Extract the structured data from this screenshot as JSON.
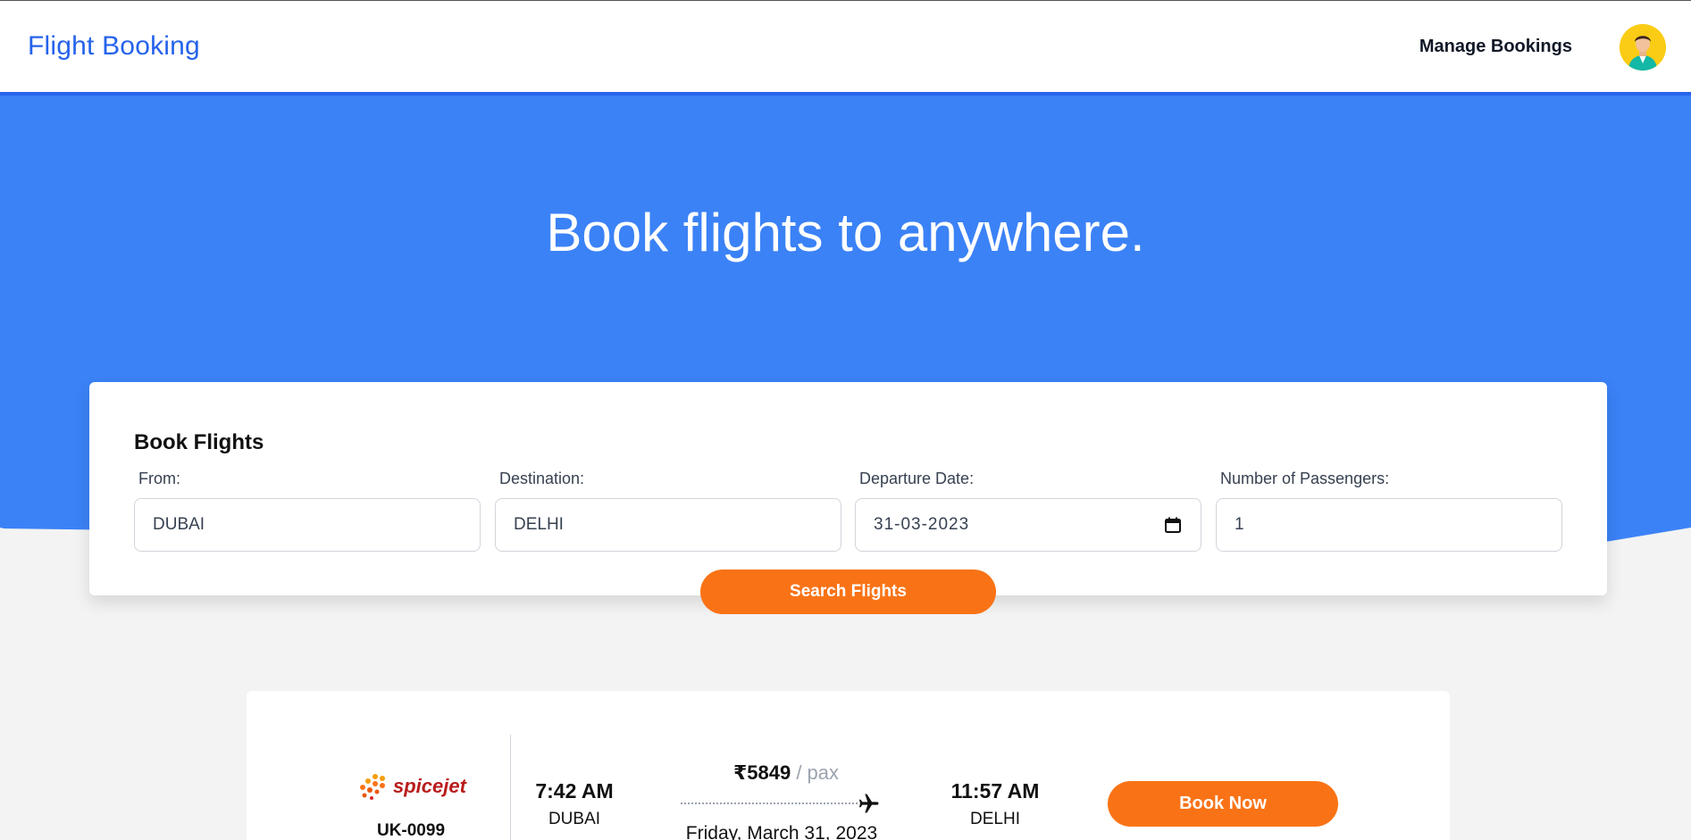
{
  "navbar": {
    "brand": "Flight Booking",
    "manage_bookings": "Manage Bookings",
    "avatar_icon": "user-avatar-icon"
  },
  "hero": {
    "title": "Book flights to anywhere."
  },
  "search_form": {
    "title": "Book Flights",
    "from": {
      "label": "From:",
      "value": "DUBAI"
    },
    "destination": {
      "label": "Destination:",
      "value": "DELHI"
    },
    "departure_date": {
      "label": "Departure Date:",
      "value": "31-03-2023"
    },
    "passengers": {
      "label": "Number of Passengers:",
      "value": "1"
    },
    "search_button": "Search Flights"
  },
  "results": [
    {
      "airline": "spicejet",
      "flight_no": "UK-0099",
      "depart_time": "7:42 AM",
      "depart_city": "DUBAI",
      "price": "₹5849",
      "price_unit": " / pax",
      "date": "Friday, March 31, 2023",
      "arrive_time": "11:57 AM",
      "arrive_city": "DELHI",
      "book_button": "Book Now"
    }
  ],
  "colors": {
    "primary": "#2563eb",
    "hero": "#3b82f6",
    "accent": "#f97316",
    "background": "#f3f3f3"
  }
}
